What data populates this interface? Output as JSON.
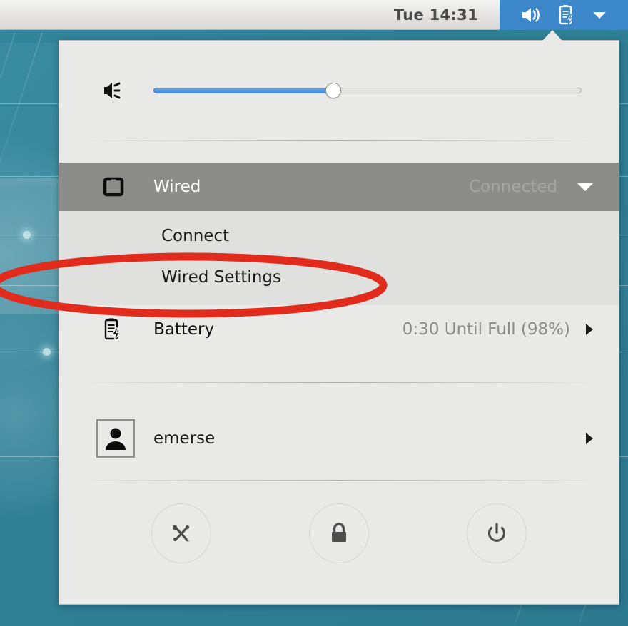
{
  "topbar": {
    "clock": "Tue 14:31",
    "icons": [
      {
        "name": "volume-icon",
        "label": "Volume"
      },
      {
        "name": "battery-charging-icon",
        "label": "Battery charging"
      },
      {
        "name": "chevron-down-icon",
        "label": "Open system menu"
      }
    ]
  },
  "menu": {
    "volume": {
      "icon": "volume-muted-low-icon",
      "value": 42,
      "min": 0,
      "max": 100
    },
    "network": {
      "icon": "wired-network-icon",
      "label": "Wired",
      "status": "Connected",
      "expander_icon": "chevron-down-icon",
      "expanded": true,
      "submenu": [
        {
          "label": "Connect"
        },
        {
          "label": "Wired Settings"
        }
      ]
    },
    "battery": {
      "icon": "battery-charging-icon",
      "label": "Battery",
      "status": "0:30 Until Full (98%)",
      "arrow_icon": "chevron-right-icon"
    },
    "user": {
      "avatar_icon": "person-avatar-icon",
      "label": "emerse",
      "arrow_icon": "chevron-right-icon"
    },
    "actions": [
      {
        "name": "settings-button",
        "icon": "tools-icon",
        "label": "Settings"
      },
      {
        "name": "lock-button",
        "icon": "lock-icon",
        "label": "Lock"
      },
      {
        "name": "power-button",
        "icon": "power-icon",
        "label": "Power Off"
      }
    ]
  },
  "annotation": {
    "shape": "ellipse",
    "color": "#e02b1d",
    "target": "Wired Settings"
  },
  "colors": {
    "panel_highlight_blue": "#3c87c9",
    "menu_background": "#e9e9e8",
    "submenu_background": "#e0e0df",
    "row_selected": "#8c8c8b",
    "slider_fill": "#4a8fd8",
    "annotation_red": "#e02b1d",
    "desktop_teal": "#2f7f95"
  }
}
